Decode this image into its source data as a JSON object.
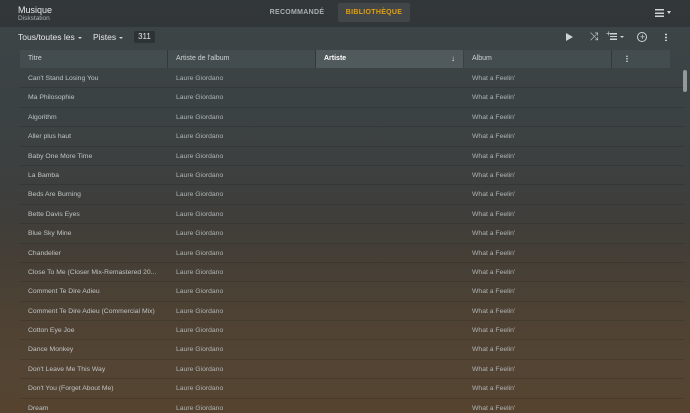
{
  "app": {
    "title": "Musique",
    "subtitle": "Diskstation"
  },
  "tabs": [
    {
      "label": "RECOMMANDÉ",
      "active": false
    },
    {
      "label": "BIBLIOTHÈQUE",
      "active": true
    }
  ],
  "accent_color": "#e5a00d",
  "toolbar": {
    "filter_label": "Tous/toutes les",
    "type_label": "Pistes",
    "count": "311",
    "icons": [
      "play-icon",
      "shuffle-icon",
      "add-to-queue-icon",
      "add-icon",
      "more-icon"
    ]
  },
  "table": {
    "columns": [
      {
        "label": "Titre"
      },
      {
        "label": "Artiste de l'album"
      },
      {
        "label": "Artiste",
        "sorted": "descending"
      },
      {
        "label": "Album"
      }
    ],
    "rows": [
      {
        "title": "Can't Stand Losing You",
        "album_artist": "Laure Giordano",
        "album": "What a Feelin'"
      },
      {
        "title": "Ma Philosophie",
        "album_artist": "Laure Giordano",
        "album": "What a Feelin'"
      },
      {
        "title": "Algorithm",
        "album_artist": "Laure Giordano",
        "album": "What a Feelin'"
      },
      {
        "title": "Aller plus haut",
        "album_artist": "Laure Giordano",
        "album": "What a Feelin'"
      },
      {
        "title": "Baby One More Time",
        "album_artist": "Laure Giordano",
        "album": "What a Feelin'"
      },
      {
        "title": "La Bamba",
        "album_artist": "Laure Giordano",
        "album": "What a Feelin'"
      },
      {
        "title": "Beds Are Burning",
        "album_artist": "Laure Giordano",
        "album": "What a Feelin'"
      },
      {
        "title": "Bette Davis Eyes",
        "album_artist": "Laure Giordano",
        "album": "What a Feelin'"
      },
      {
        "title": "Blue Sky Mine",
        "album_artist": "Laure Giordano",
        "album": "What a Feelin'"
      },
      {
        "title": "Chandelier",
        "album_artist": "Laure Giordano",
        "album": "What a Feelin'"
      },
      {
        "title": "Close To Me (Closer Mix-Remastered 20...",
        "album_artist": "Laure Giordano",
        "album": "What a Feelin'"
      },
      {
        "title": "Comment Te Dire Adieu",
        "album_artist": "Laure Giordano",
        "album": "What a Feelin'"
      },
      {
        "title": "Comment Te Dire Adieu (Commercial Mix)",
        "album_artist": "Laure Giordano",
        "album": "What a Feelin'"
      },
      {
        "title": "Cotton Eye Joe",
        "album_artist": "Laure Giordano",
        "album": "What a Feelin'"
      },
      {
        "title": "Dance Monkey",
        "album_artist": "Laure Giordano",
        "album": "What a Feelin'"
      },
      {
        "title": "Don't Leave Me This Way",
        "album_artist": "Laure Giordano",
        "album": "What a Feelin'"
      },
      {
        "title": "Don't You (Forget About Me)",
        "album_artist": "Laure Giordano",
        "album": "What a Feelin'"
      },
      {
        "title": "Dream",
        "album_artist": "Laure Giordano",
        "album": "What a Feelin'"
      }
    ]
  }
}
